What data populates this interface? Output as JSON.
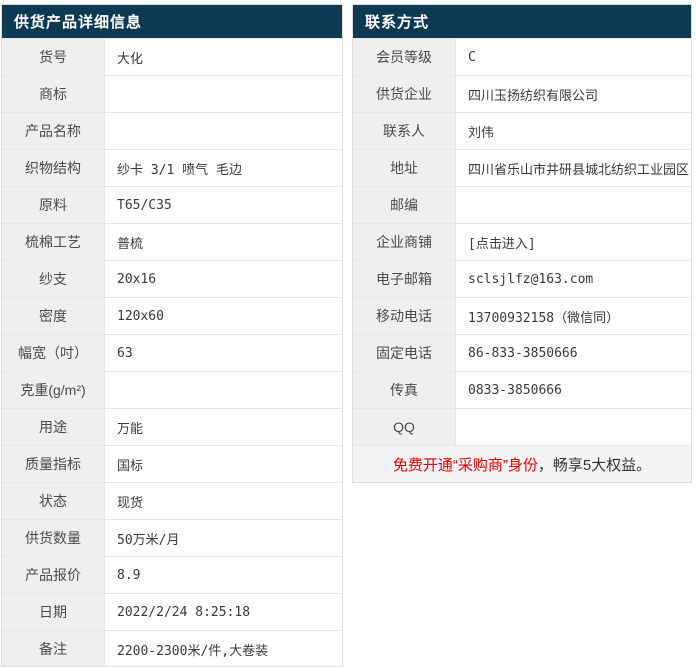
{
  "theme": {
    "header_bg": "#0d3a52",
    "label_bg": "#efefef",
    "row_border": "#e6e6e6",
    "outer_border": "#dddddd",
    "red": "#e60000"
  },
  "product_table": {
    "title": "供货产品详细信息",
    "rows": [
      {
        "label": "货号",
        "value": "大化"
      },
      {
        "label": "商标",
        "value": ""
      },
      {
        "label": "产品名称",
        "value": ""
      },
      {
        "label": "织物结构",
        "value": "纱卡 3/1 喷气 毛边"
      },
      {
        "label": "原料",
        "value": "T65/C35"
      },
      {
        "label": "梳棉工艺",
        "value": "普梳"
      },
      {
        "label": "纱支",
        "value": "20x16"
      },
      {
        "label": "密度",
        "value": "120x60"
      },
      {
        "label": "幅宽（吋）",
        "value": "63"
      },
      {
        "label": "克重(g/m²)",
        "value": ""
      },
      {
        "label": "用途",
        "value": "万能"
      },
      {
        "label": "质量指标",
        "value": "国标"
      },
      {
        "label": "状态",
        "value": "现货"
      },
      {
        "label": "供货数量",
        "value": "50万米/月"
      },
      {
        "label": "产品报价",
        "value": "8.9"
      },
      {
        "label": "日期",
        "value": "2022/2/24 8:25:18"
      },
      {
        "label": "备注",
        "value": "2200-2300米/件,大卷装"
      }
    ]
  },
  "contact_table": {
    "title": "联系方式",
    "rows": [
      {
        "label": "会员等级",
        "value": "C"
      },
      {
        "label": "供货企业",
        "value": "四川玉扬纺织有限公司"
      },
      {
        "label": "联系人",
        "value": "刘伟"
      },
      {
        "label": "地址",
        "value": "四川省乐山市井研县城北纺织工业园区"
      },
      {
        "label": "邮编",
        "value": ""
      },
      {
        "label": "企业商铺",
        "value": "[点击进入]",
        "link": true
      },
      {
        "label": "电子邮箱",
        "value": "sclsjlfz@163.com"
      },
      {
        "label": "移动电话",
        "value": "13700932158（微信同）"
      },
      {
        "label": "固定电话",
        "value": "86-833-3850666"
      },
      {
        "label": "传真",
        "value": "0833-3850666"
      },
      {
        "label": "QQ",
        "value": ""
      }
    ],
    "footer": {
      "red_text": "免费开通“采购商”身份",
      "normal_text": "，畅享5大权益。"
    }
  }
}
